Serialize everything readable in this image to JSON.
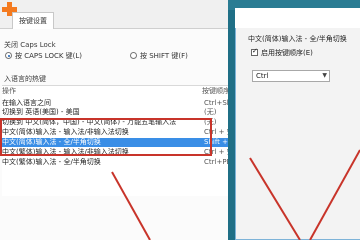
{
  "tabs": {
    "active_label": "按键设置"
  },
  "caps_group": {
    "title": "关闭 Caps Lock",
    "option_caps": "按 CAPS LOCK 键(L)",
    "option_shift": "按 SHIFT 键(F)",
    "selected": "option_caps"
  },
  "hotkeys": {
    "section_title": "入语言的热键",
    "columns": [
      "操作",
      "按键顺序"
    ],
    "rows": [
      {
        "action": "在输入语言之间",
        "keys": "Ctrl+Shift"
      },
      {
        "action": "切换到 英语(美国) - 美国",
        "keys": "(无)"
      },
      {
        "action": "切换到 中文(简体，中国) - 中文(简体) - 万能五笔输入法",
        "keys": "(无)"
      },
      {
        "action": "中文(简体)输入法 - 输入法/非输入法切换",
        "keys": "Ctrl + 空格"
      },
      {
        "action": "中文(简体)输入法 - 全/半角切换",
        "keys": "Shift + 空格"
      },
      {
        "action": "中文(繁体)输入法 - 输入法/非输入法切换",
        "keys": "Ctrl + 空格"
      },
      {
        "action": "中文(繁体)输入法 - 全/半角切换",
        "keys": "Ctrl+PERIOD"
      }
    ],
    "selected_index": 4
  },
  "dialog": {
    "title": "中文(简体)输入法 - 全/半角切换",
    "enable_checkbox_label": "启用按键顺序(E)",
    "enable_checked": true,
    "modifier_select_value": "Ctrl"
  },
  "colors": {
    "highlight": "#3a8ee6",
    "annotation_red": "#c8342a",
    "titlebar_teal": "#1f6f86"
  }
}
